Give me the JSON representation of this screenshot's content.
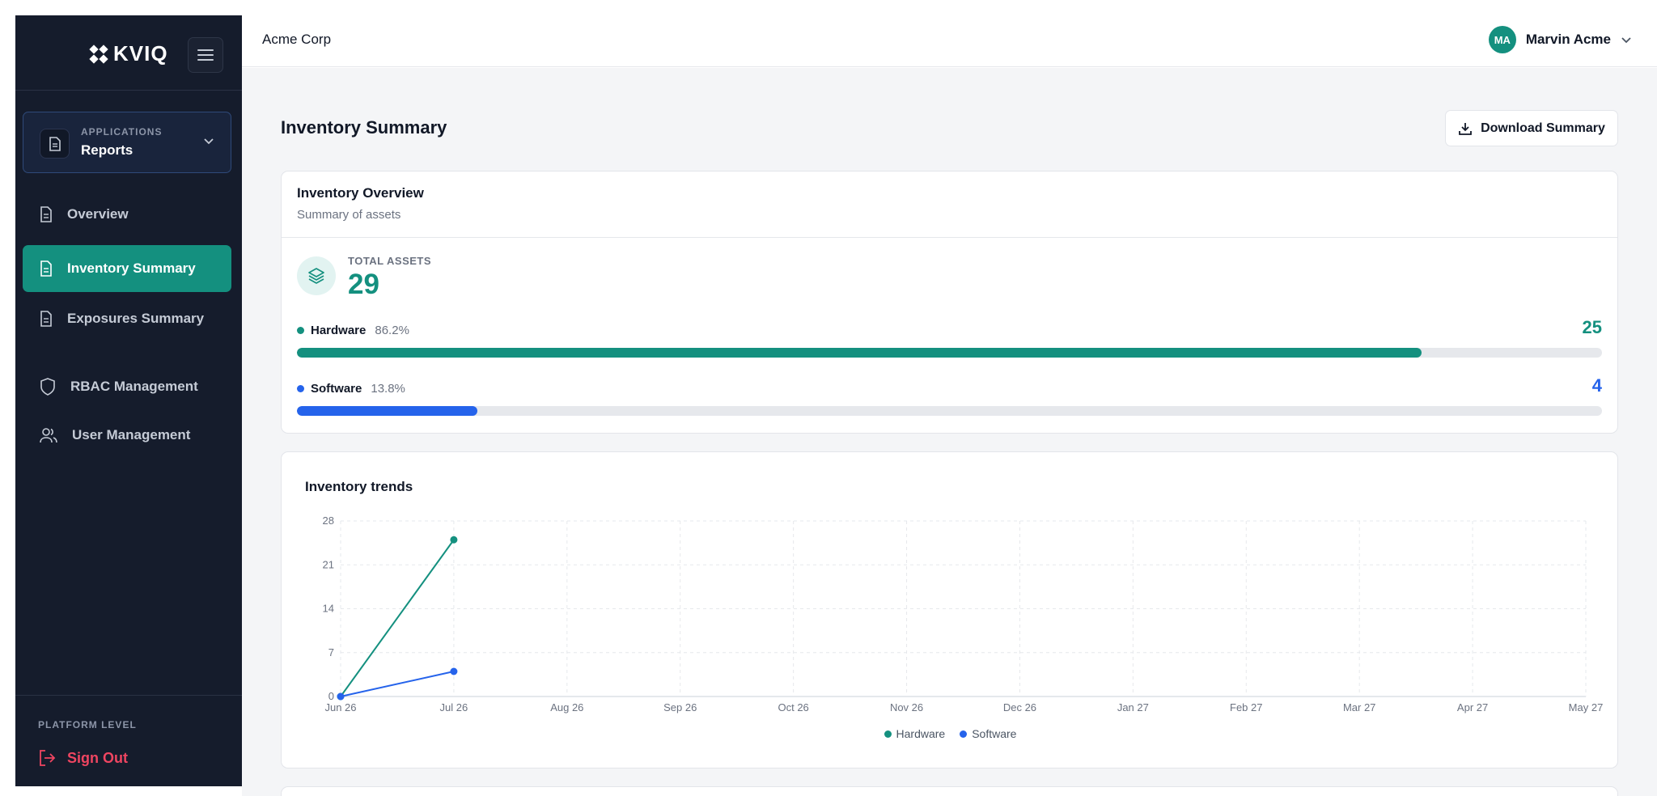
{
  "brand": {
    "name": "KVIQ"
  },
  "sidebar": {
    "app_selector": {
      "caption": "APPLICATIONS",
      "value": "Reports"
    },
    "items": [
      {
        "label": "Overview",
        "icon": "document-icon",
        "active": false
      },
      {
        "label": "Inventory Summary",
        "icon": "document-icon",
        "active": true
      },
      {
        "label": "Exposures Summary",
        "icon": "document-icon",
        "active": false
      },
      {
        "label": "RBAC Management",
        "icon": "shield-icon",
        "active": false
      },
      {
        "label": "User Management",
        "icon": "users-icon",
        "active": false
      }
    ],
    "footer": {
      "caption": "PLATFORM LEVEL",
      "signout_label": "Sign Out"
    }
  },
  "topbar": {
    "org": "Acme Corp",
    "user": {
      "initials": "MA",
      "name": "Marvin Acme"
    }
  },
  "page": {
    "title": "Inventory Summary",
    "download_label": "Download Summary"
  },
  "overview": {
    "title": "Inventory Overview",
    "subtitle": "Summary of assets",
    "total_label": "TOTAL ASSETS",
    "total_value": "29",
    "rows": [
      {
        "name": "Hardware",
        "pct": "86.2%",
        "count": "25",
        "fraction": 0.862,
        "color": "#14907f"
      },
      {
        "name": "Software",
        "pct": "13.8%",
        "count": "4",
        "fraction": 0.138,
        "color": "#2563eb"
      }
    ]
  },
  "trends": {
    "title": "Inventory trends",
    "legend": [
      "Hardware",
      "Software"
    ]
  },
  "colors": {
    "accent": "#14907f",
    "software": "#2563eb",
    "danger": "#ef4561",
    "sidebar_bg": "#151c2c"
  },
  "chart_data": {
    "type": "line",
    "title": "Inventory trends",
    "x": [
      "Jun 26",
      "Jul 26",
      "Aug 26",
      "Sep 26",
      "Oct 26",
      "Nov 26",
      "Dec 26",
      "Jan 27",
      "Feb 27",
      "Mar 27",
      "Apr 27",
      "May 27"
    ],
    "series": [
      {
        "name": "Hardware",
        "values": [
          0,
          25
        ],
        "color": "#14907f"
      },
      {
        "name": "Software",
        "values": [
          0,
          4
        ],
        "color": "#2563eb"
      }
    ],
    "yticks": [
      0,
      7,
      14,
      21,
      28
    ],
    "ylim": [
      0,
      28
    ],
    "grid": true,
    "legend_position": "bottom"
  }
}
